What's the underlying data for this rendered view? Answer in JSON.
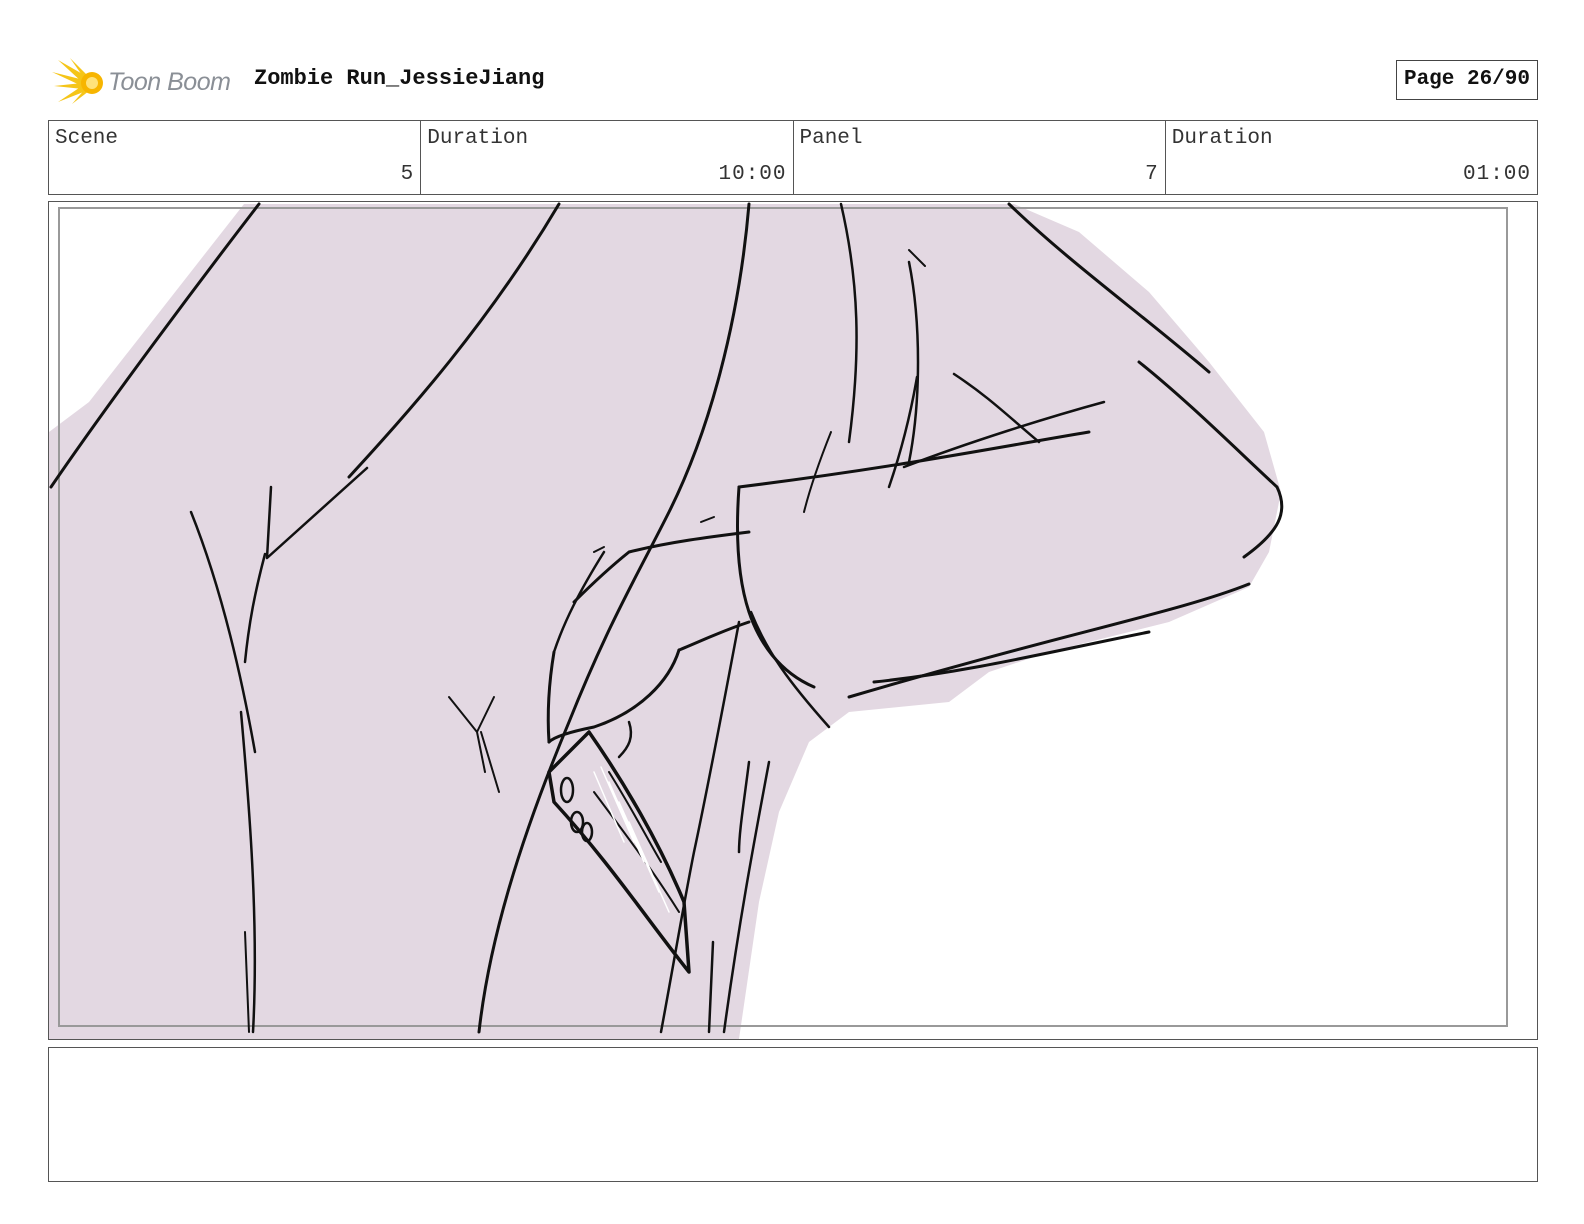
{
  "header": {
    "logo_text": "Toon Boom",
    "title": "Zombie Run_JessieJiang",
    "page_label": "Page 26/90"
  },
  "info": {
    "scene_label": "Scene",
    "scene_value": "5",
    "scene_duration_label": "Duration",
    "scene_duration_value": "10:00",
    "panel_label": "Panel",
    "panel_value": "7",
    "panel_duration_label": "Duration",
    "panel_duration_value": "01:00"
  },
  "notes": {
    "text": ""
  },
  "colors": {
    "sketch_fill": "#e3d8e2",
    "line": "#111111",
    "logo_yellow": "#f5c518",
    "safe_frame": "#999999"
  }
}
